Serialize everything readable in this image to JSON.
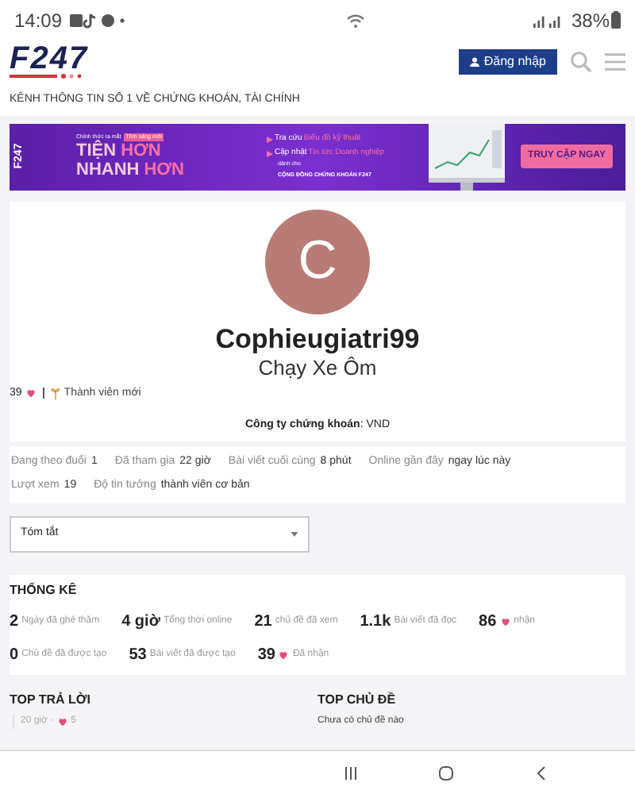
{
  "status_bar": {
    "time": "14:09",
    "battery": "38%"
  },
  "header": {
    "logo": "F247",
    "login_button": "Đăng nhập",
    "tagline": "KÊNH THÔNG TIN SỐ 1 VỀ CHỨNG KHOÁN, TÀI CHÍNH"
  },
  "banner": {
    "brand": "F247",
    "launch": "Chính thức ra mắt",
    "badge": "Tính năng mới",
    "headline": [
      [
        {
          "text": "TIỆN",
          "accent": false
        },
        {
          "text": "HƠN",
          "accent": true
        }
      ],
      [
        {
          "text": "NHANH",
          "accent": false
        },
        {
          "text": "HƠN",
          "accent": true
        }
      ]
    ],
    "features": [
      {
        "label": "Tra cứu",
        "value": "Biểu đồ kỹ thuật"
      },
      {
        "label": "Cập nhật",
        "value": "Tin tức Doanh nghiệp"
      }
    ],
    "for_label": "dành cho",
    "community": "CỘNG ĐỒNG CHỨNG KHOÁN F247",
    "cta": "TRUY CẬP NGAY"
  },
  "profile": {
    "avatar_letter": "C",
    "username": "Cophieugiatri99",
    "title": "Chạy Xe Ôm",
    "likes": "39",
    "rank": "Thành viên mới",
    "company": "**Công ty chứng khoán**: VND"
  },
  "info": [
    [
      {
        "label": "Đang theo đuổi",
        "value": "1"
      },
      {
        "label": "Đã tham gia",
        "value": "22 giờ"
      },
      {
        "label": "Bài viết cuối cùng",
        "value": "8 phút"
      },
      {
        "label": "Online gần đây",
        "value": "ngay lúc này"
      }
    ],
    [
      {
        "label": "Lượt xem",
        "value": "19"
      },
      {
        "label": "Độ tin tưởng",
        "value": "thành viên cơ bản"
      }
    ]
  ],
  "dropdown": {
    "value": "Tóm tắt"
  },
  "stats": {
    "title": "THỐNG KÊ",
    "items": [
      [
        {
          "value": "2",
          "label": "Ngày đã ghé thăm",
          "heart": false
        },
        {
          "value": "4 giờ",
          "label": "Tổng thời online",
          "heart": false
        },
        {
          "value": "21",
          "label": "chủ đề đã xem",
          "heart": false
        },
        {
          "value": "1.1k",
          "label": "Bài viết đã đọc",
          "heart": false
        },
        {
          "value": "86",
          "label": "nhận",
          "heart": true
        }
      ],
      [
        {
          "value": "0",
          "label": "Chủ đề đã được tạo",
          "heart": false
        },
        {
          "value": "53",
          "label": "Bài viết đã được tạo",
          "heart": false
        },
        {
          "value": "39",
          "label": "Đã nhận",
          "heart": true
        }
      ]
    ]
  },
  "top_replies": {
    "title": "TOP TRẢ LỜI",
    "items": [
      {
        "time": "20 giờ ·",
        "likes": "5"
      }
    ]
  },
  "top_topics": {
    "title": "TOP CHỦ ĐỀ",
    "empty": "Chưa có chủ đề nào"
  }
}
